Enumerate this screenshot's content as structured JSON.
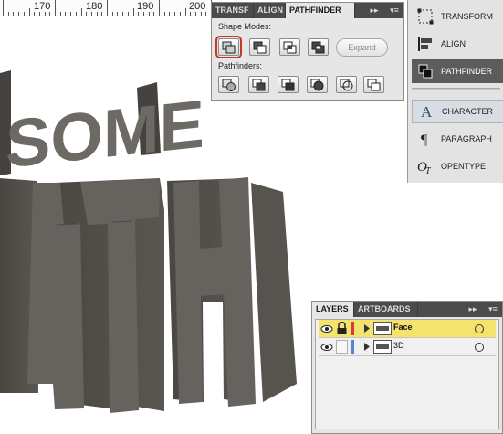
{
  "ruler": {
    "ticks": [
      "170",
      "180",
      "190",
      "200"
    ]
  },
  "artwork": {
    "line1": "SOME",
    "line2": "TH",
    "color": "#5f5b57",
    "shadow": "#3e3b38"
  },
  "pathfinder_panel": {
    "tabs": [
      "TRANSF",
      "ALIGN",
      "PATHFINDER"
    ],
    "active_tab": "PATHFINDER",
    "collapse_glyph": "▸▸",
    "menu_glyph": "▾≡",
    "shape_modes_label": "Shape Modes:",
    "pathfinders_label": "Pathfinders:",
    "expand_label": "Expand",
    "shape_mode_icons": [
      "unite-icon",
      "minus-front-icon",
      "intersect-icon",
      "exclude-icon"
    ],
    "pathfinder_icons": [
      "divide-icon",
      "trim-icon",
      "merge-icon",
      "crop-icon",
      "outline-icon",
      "minus-back-icon"
    ]
  },
  "dock": {
    "items": [
      {
        "label": "TRANSFORM",
        "icon": "transform-icon"
      },
      {
        "label": "ALIGN",
        "icon": "align-icon"
      },
      {
        "label": "PATHFINDER",
        "icon": "pathfinder-icon",
        "active": true
      },
      {
        "label": "CHARACTER",
        "icon": "character-icon",
        "highlighted": true
      },
      {
        "label": "PARAGRAPH",
        "icon": "paragraph-icon"
      },
      {
        "label": "OPENTYPE",
        "icon": "opentype-icon"
      }
    ]
  },
  "layers_panel": {
    "tabs": [
      "LAYERS",
      "ARTBOARDS"
    ],
    "active_tab": "LAYERS",
    "collapse_glyph": "▸▸",
    "menu_glyph": "▾≡",
    "layers": [
      {
        "name": "Face",
        "selected": true,
        "locked": true,
        "color": "#e0393d"
      },
      {
        "name": "3D",
        "selected": false,
        "locked": false,
        "color": "#5b7fd6"
      }
    ]
  }
}
